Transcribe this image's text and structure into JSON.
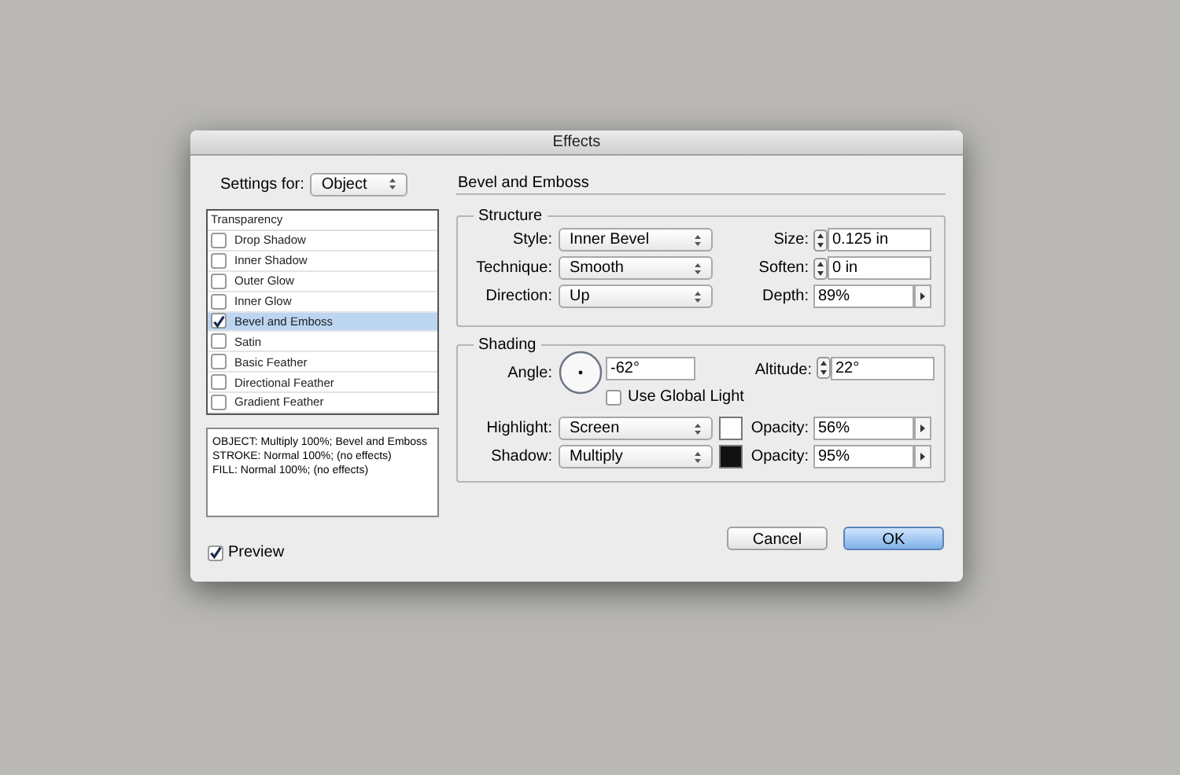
{
  "window": {
    "title": "Effects"
  },
  "settings_for": {
    "label": "Settings for:",
    "value": "Object"
  },
  "effects_list": {
    "header": "Transparency",
    "items": [
      {
        "label": "Drop Shadow",
        "checked": false,
        "selected": false
      },
      {
        "label": "Inner Shadow",
        "checked": false,
        "selected": false
      },
      {
        "label": "Outer Glow",
        "checked": false,
        "selected": false
      },
      {
        "label": "Inner Glow",
        "checked": false,
        "selected": false
      },
      {
        "label": "Bevel and Emboss",
        "checked": true,
        "selected": true
      },
      {
        "label": "Satin",
        "checked": false,
        "selected": false
      },
      {
        "label": "Basic Feather",
        "checked": false,
        "selected": false
      },
      {
        "label": "Directional Feather",
        "checked": false,
        "selected": false
      },
      {
        "label": "Gradient Feather",
        "checked": false,
        "selected": false
      }
    ]
  },
  "summary": [
    "OBJECT: Multiply 100%; Bevel and Emboss",
    "STROKE: Normal 100%; (no effects)",
    "FILL: Normal 100%; (no effects)"
  ],
  "preview": {
    "label": "Preview",
    "checked": true
  },
  "panel_title": "Bevel and Emboss",
  "structure": {
    "title": "Structure",
    "rows": [
      {
        "label": "Style:",
        "value": "Inner Bevel",
        "field_label": "Size:",
        "field_value": "0.125 in",
        "kind": "stepper"
      },
      {
        "label": "Technique:",
        "value": "Smooth",
        "field_label": "Soften:",
        "field_value": "0 in",
        "kind": "stepper"
      },
      {
        "label": "Direction:",
        "value": "Up",
        "field_label": "Depth:",
        "field_value": "89%",
        "kind": "slider"
      }
    ]
  },
  "shading": {
    "title": "Shading",
    "angle_label": "Angle:",
    "angle_value": "-62°",
    "altitude_label": "Altitude:",
    "altitude_value": "22°",
    "global_light": {
      "label": "Use Global Light",
      "checked": false
    },
    "modes": [
      {
        "label": "Highlight:",
        "value": "Screen",
        "color": "#ffffff",
        "opacity_label": "Opacity:",
        "opacity_value": "56%"
      },
      {
        "label": "Shadow:",
        "value": "Multiply",
        "color": "#111111",
        "opacity_label": "Opacity:",
        "opacity_value": "95%"
      }
    ]
  },
  "buttons": [
    {
      "label": "Cancel",
      "default": false
    },
    {
      "label": "OK",
      "default": true
    }
  ]
}
